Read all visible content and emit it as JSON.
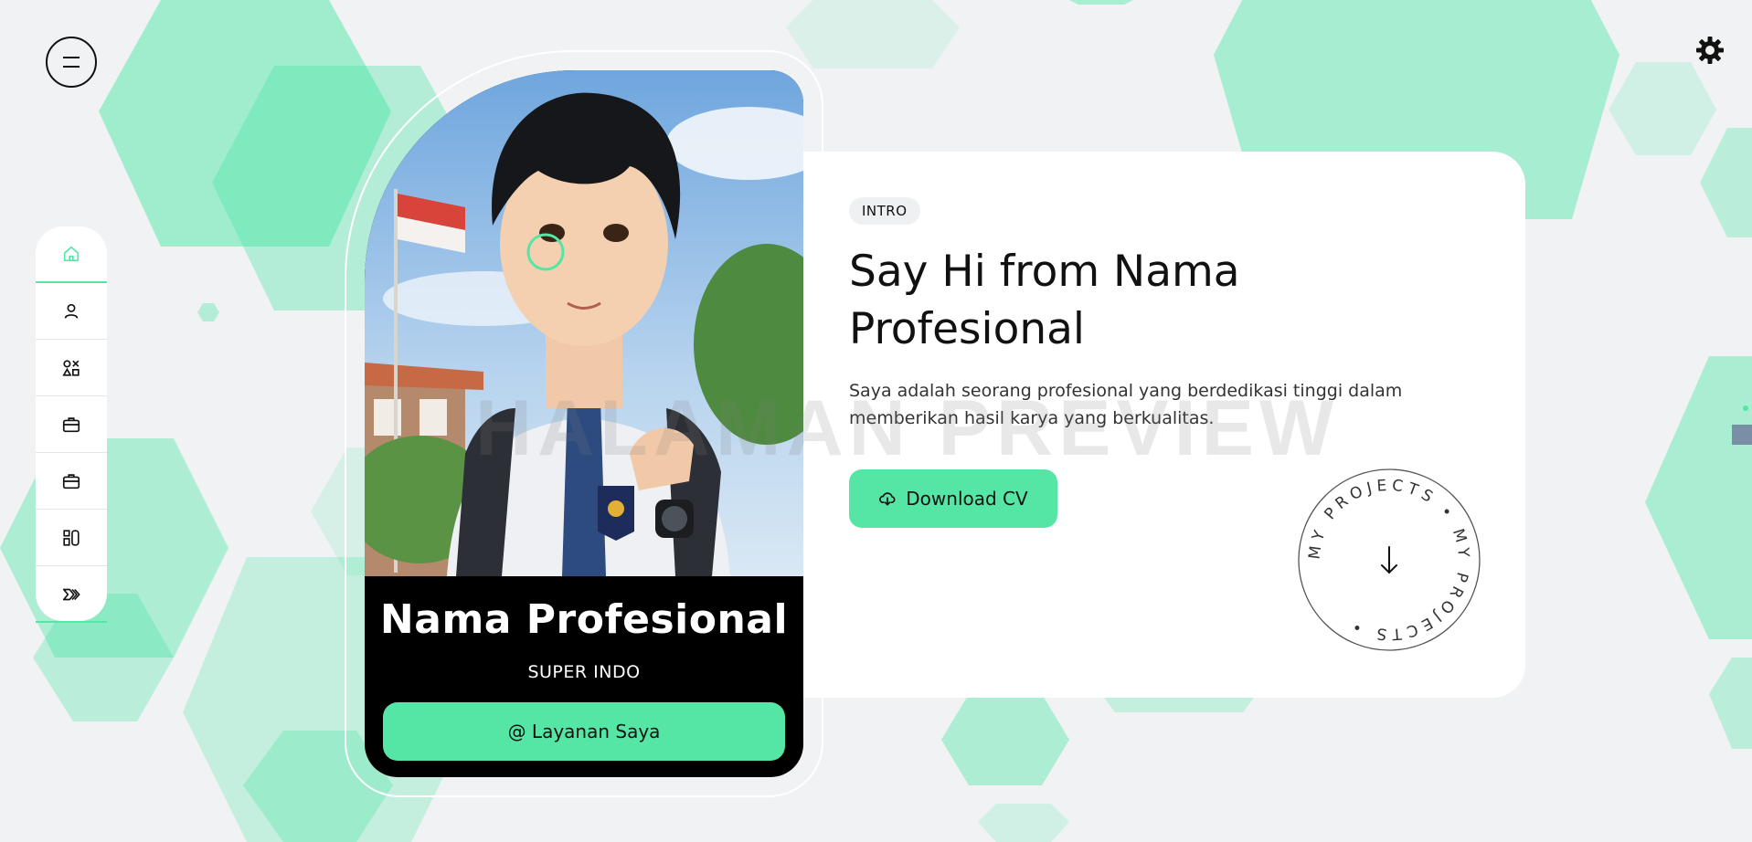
{
  "header": {
    "menu_icon": "menu-icon",
    "theme_icon": "gear-icon"
  },
  "sidebar": {
    "items": [
      {
        "icon": "home-icon",
        "active": true
      },
      {
        "icon": "user-icon",
        "active": false
      },
      {
        "icon": "shapes-icon",
        "active": false
      },
      {
        "icon": "briefcase-icon",
        "active": false
      },
      {
        "icon": "briefcase-icon",
        "active": false
      },
      {
        "icon": "layout-icon",
        "active": false
      },
      {
        "icon": "double-chevron-right-icon",
        "active": false
      }
    ]
  },
  "profile": {
    "name": "Nama Profesional",
    "role": "SUPER INDO",
    "services_button": "@ Layanan Saya"
  },
  "intro": {
    "badge": "INTRO",
    "headline": "Say Hi from Nama Profesional",
    "description": "Saya adalah seorang profesional yang berdedikasi tinggi dalam memberikan hasil karya yang berkualitas.",
    "download_button": "Download CV",
    "download_icon": "cloud-download-icon",
    "projects_text": "MY PROJECTS • MY PROJECTS •",
    "projects_icon": "arrow-down-icon"
  },
  "watermark": "HALAMAN PREVIEW",
  "colors": {
    "accent": "#55e6a5",
    "background": "#f1f2f4",
    "card": "#ffffff",
    "dark": "#000000"
  }
}
